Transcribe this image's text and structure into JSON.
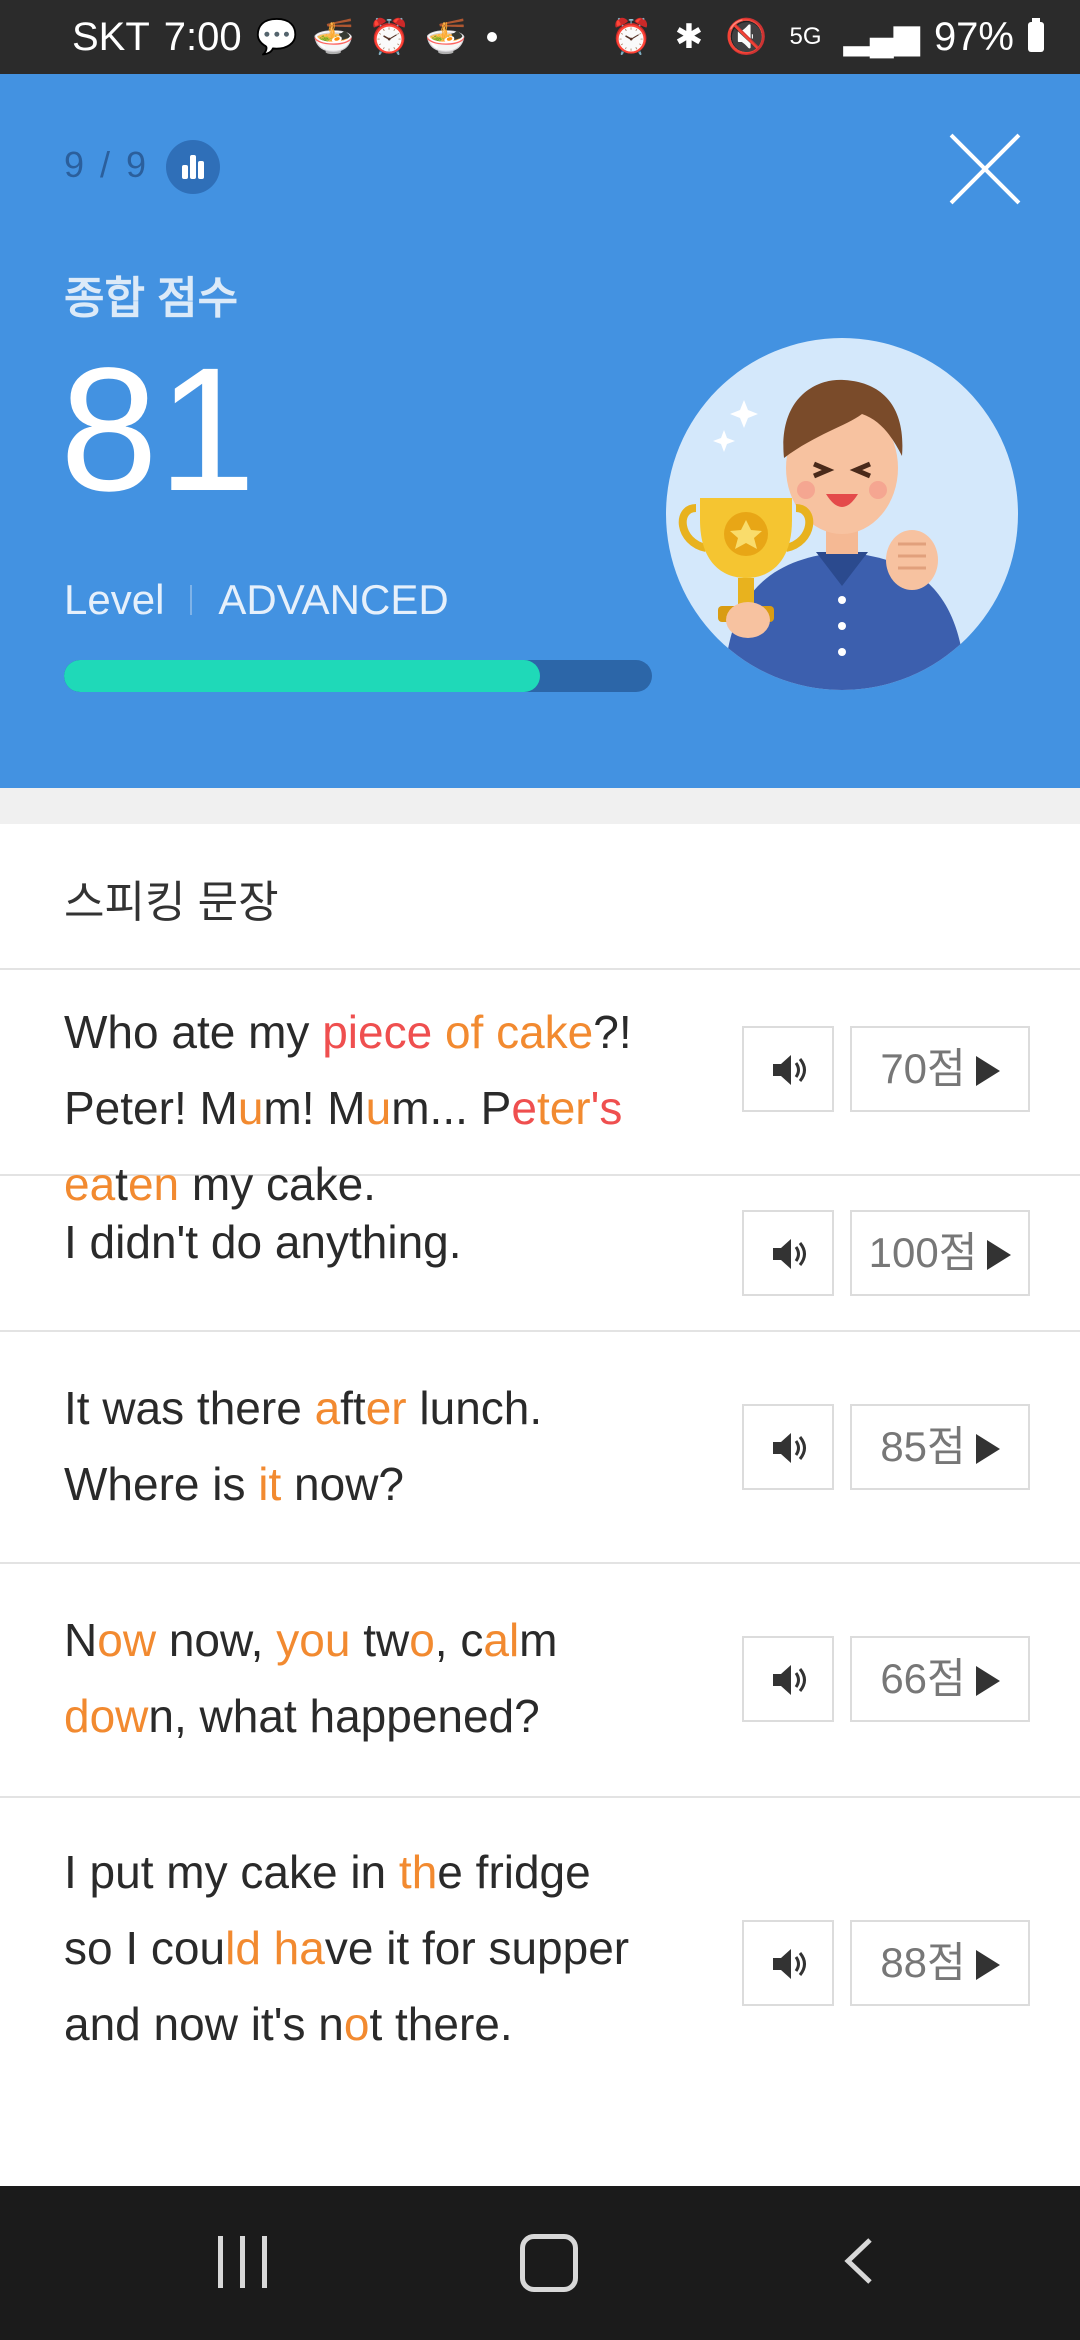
{
  "status_bar": {
    "carrier": "SKT",
    "time": "7:00",
    "battery": "97%"
  },
  "header": {
    "progress": "9 / 9",
    "score_title": "종합 점수",
    "score": "81",
    "level_label": "Level",
    "level_value": "ADVANCED",
    "level_progress_fraction": 0.81,
    "colors": {
      "background": "#4392e1",
      "bar_fill": "#1fd9b8",
      "bar_track": "#2c66a8"
    }
  },
  "section": {
    "title": "스피킹 문장"
  },
  "sentences": [
    {
      "score_label": "70점"
    },
    {
      "score_label": "100점"
    },
    {
      "score_label": "85점"
    },
    {
      "score_label": "66점"
    },
    {
      "score_label": "88점"
    }
  ],
  "sentence_texts": [
    [
      [
        "Who ate my ",
        ""
      ],
      [
        "piece ",
        "r"
      ],
      [
        "of cake",
        "o"
      ],
      [
        "?!",
        ""
      ],
      [
        "\n",
        ""
      ],
      [
        "Peter! M",
        ""
      ],
      [
        "u",
        "o"
      ],
      [
        "m! M",
        ""
      ],
      [
        "u",
        "o"
      ],
      [
        "m... P",
        ""
      ],
      [
        "e",
        "r"
      ],
      [
        "ter",
        "o"
      ],
      [
        "'s",
        "r"
      ],
      [
        "\n",
        ""
      ],
      [
        "ea",
        "o"
      ],
      [
        "t",
        ""
      ],
      [
        "en",
        "o"
      ],
      [
        " my cake.",
        ""
      ]
    ],
    [
      [
        "I didn't do anything.",
        ""
      ]
    ],
    [
      [
        "It was there ",
        ""
      ],
      [
        "a",
        "o"
      ],
      [
        "ft",
        ""
      ],
      [
        "er",
        "o"
      ],
      [
        " lunch.",
        ""
      ],
      [
        "\n",
        ""
      ],
      [
        "Where is ",
        ""
      ],
      [
        "it",
        "o"
      ],
      [
        " now?",
        ""
      ]
    ],
    [
      [
        "N",
        ""
      ],
      [
        "ow",
        "o"
      ],
      [
        " now, ",
        ""
      ],
      [
        "you",
        "o"
      ],
      [
        " tw",
        ""
      ],
      [
        "o",
        "o"
      ],
      [
        ", c",
        ""
      ],
      [
        "al",
        "o"
      ],
      [
        "m",
        ""
      ],
      [
        "\n",
        ""
      ],
      [
        "dow",
        "o"
      ],
      [
        "n, what happened?",
        ""
      ]
    ],
    [
      [
        "I put my cake in ",
        ""
      ],
      [
        "th",
        "o"
      ],
      [
        "e fridge",
        ""
      ],
      [
        "\n",
        ""
      ],
      [
        "so I cou",
        ""
      ],
      [
        "ld ha",
        "o"
      ],
      [
        "ve it for supper",
        ""
      ],
      [
        "\n",
        ""
      ],
      [
        "and now it's n",
        ""
      ],
      [
        "o",
        "o"
      ],
      [
        "t there.",
        ""
      ]
    ]
  ],
  "icons": {
    "close": "close-icon",
    "chart": "bar-chart-icon",
    "speaker": "speaker-icon",
    "play": "play-icon",
    "trophy_avatar": "trophy-character-illustration"
  }
}
